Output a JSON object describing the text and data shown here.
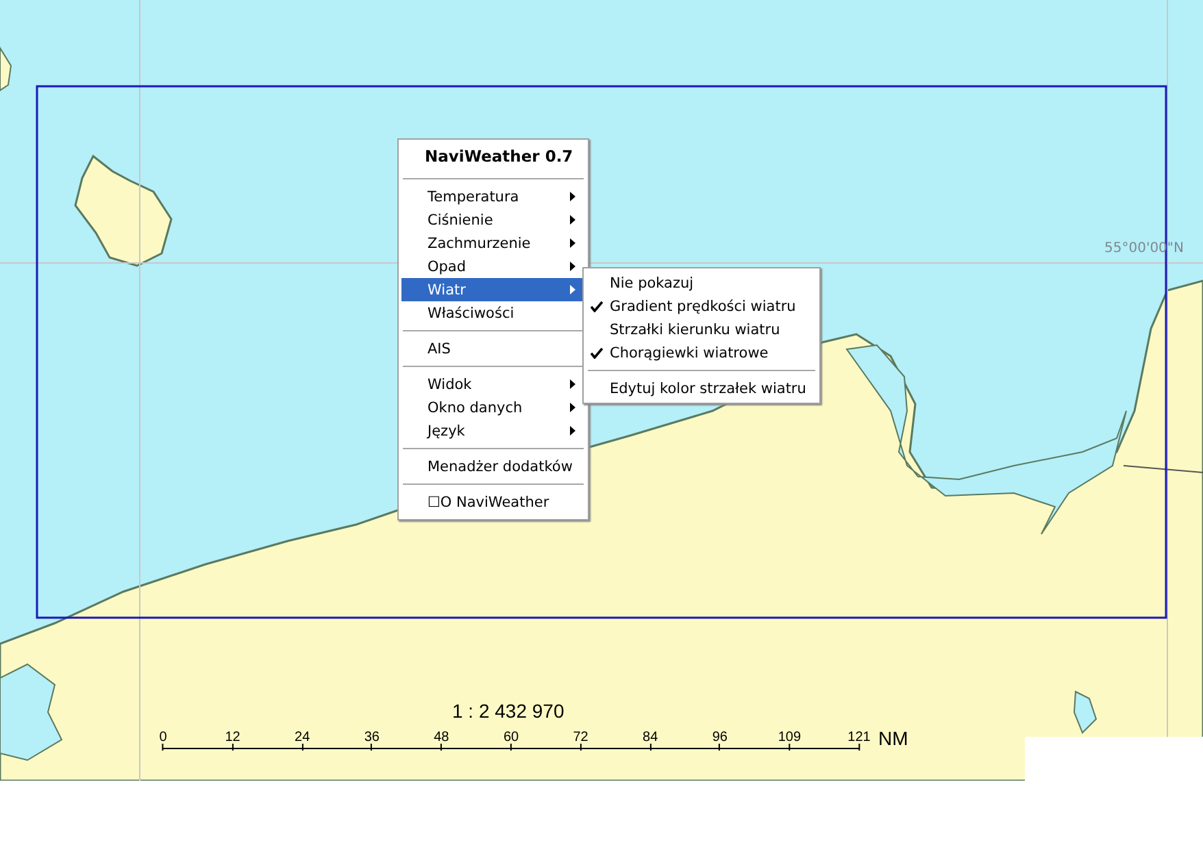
{
  "map": {
    "grid_label": "55°00'00\"N"
  },
  "context_menu": {
    "title": "NaviWeather 0.7",
    "items": [
      {
        "kind": "separator"
      },
      {
        "kind": "item",
        "label": "Temperatura",
        "has_submenu": true,
        "selected": false
      },
      {
        "kind": "item",
        "label": "Ciśnienie",
        "has_submenu": true,
        "selected": false
      },
      {
        "kind": "item",
        "label": "Zachmurzenie",
        "has_submenu": true,
        "selected": false
      },
      {
        "kind": "item",
        "label": "Opad",
        "has_submenu": true,
        "selected": false
      },
      {
        "kind": "item",
        "label": "Wiatr",
        "has_submenu": true,
        "selected": true
      },
      {
        "kind": "item",
        "label": "Właściwości",
        "has_submenu": false,
        "selected": false
      },
      {
        "kind": "separator"
      },
      {
        "kind": "item",
        "label": "AIS",
        "has_submenu": false,
        "selected": false
      },
      {
        "kind": "separator"
      },
      {
        "kind": "item",
        "label": "Widok",
        "has_submenu": true,
        "selected": false
      },
      {
        "kind": "item",
        "label": "Okno danych",
        "has_submenu": true,
        "selected": false
      },
      {
        "kind": "item",
        "label": "Język",
        "has_submenu": true,
        "selected": false
      },
      {
        "kind": "separator"
      },
      {
        "kind": "item",
        "label": "Menadżer dodatków",
        "has_submenu": false,
        "selected": false
      },
      {
        "kind": "separator"
      },
      {
        "kind": "item",
        "label": "☐O NaviWeather",
        "has_submenu": false,
        "selected": false
      }
    ]
  },
  "submenu": {
    "items": [
      {
        "kind": "item",
        "label": "Nie pokazuj",
        "checked": false
      },
      {
        "kind": "item",
        "label": "Gradient prędkości wiatru",
        "checked": true
      },
      {
        "kind": "item",
        "label": "Strzałki kierunku wiatru",
        "checked": false
      },
      {
        "kind": "item",
        "label": "Chorągiewki wiatrowe",
        "checked": true
      },
      {
        "kind": "separator"
      },
      {
        "kind": "item",
        "label": "Edytuj kolor strzałek wiatru",
        "checked": false
      }
    ]
  },
  "scale_bar": {
    "ratio": "1 : 2 432 970",
    "ticks": [
      "0",
      "12",
      "24",
      "36",
      "48",
      "60",
      "72",
      "84",
      "96",
      "109",
      "121"
    ],
    "unit": "NM"
  }
}
